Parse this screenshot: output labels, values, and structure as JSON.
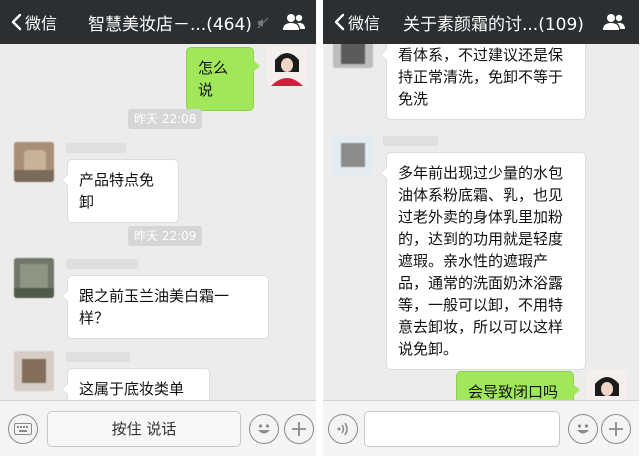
{
  "left_chat": {
    "back_label": "微信",
    "title": "智慧美妆店－...(464)",
    "messages": [
      {
        "from": "me",
        "text": "怎么说"
      },
      {
        "type": "time",
        "text": "昨天 22:08"
      },
      {
        "from": "other",
        "text": "产品特点免卸"
      },
      {
        "type": "time",
        "text": "昨天 22:09"
      },
      {
        "from": "other",
        "text": "跟之前玉兰油美白霜一样？"
      },
      {
        "from": "other",
        "text": "这属于底妆类单品"
      }
    ],
    "input": {
      "hold_to_talk_label": "按住 说话"
    }
  },
  "right_chat": {
    "back_label": "微信",
    "title": "关于素颜霜的讨...(109)",
    "messages": [
      {
        "from": "other",
        "text": "看体系，不过建议还是保持正常清洗，免卸不等于免洗"
      },
      {
        "from": "other",
        "text": "多年前出现过少量的水包油体系粉底霜、乳，也见过老外卖的身体乳里加粉的，达到的功用就是轻度遮瑕。亲水性的遮瑕产品，通常的洗面奶沐浴露等，一般可以卸，不用特意去卸妆，所以可以这样说免卸。"
      },
      {
        "from": "me",
        "text": "会导致闭口吗"
      }
    ]
  },
  "icons": {
    "back": "chevron-left-icon",
    "members": "group-members-icon",
    "mute": "mute-icon",
    "keyboard": "keyboard-icon",
    "voice": "voice-icon",
    "emoji": "emoji-icon",
    "more": "plus-icon"
  },
  "colors": {
    "header_bg": "#2b2f31",
    "chat_bg": "#ececec",
    "sent_bubble": "#a0e759",
    "received_bubble": "#ffffff"
  }
}
